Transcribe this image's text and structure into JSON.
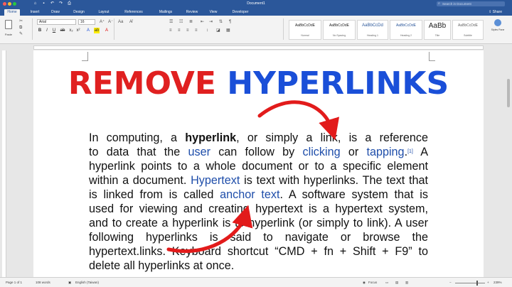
{
  "window": {
    "title": "Document1",
    "search_placeholder": "Search in Document",
    "share_label": "Share"
  },
  "tabs": [
    "Home",
    "Insert",
    "Draw",
    "Design",
    "Layout",
    "References",
    "Mailings",
    "Review",
    "View",
    "Developer"
  ],
  "active_tab": "Home",
  "ribbon": {
    "paste_label": "Paste",
    "font_name": "Arial",
    "font_size": "16",
    "styles": [
      {
        "sample": "AaBbCcDdE",
        "name": "Normal"
      },
      {
        "sample": "AaBbCcDdE",
        "name": "No Spacing"
      },
      {
        "sample": "AaBbCcDd",
        "name": "Heading 1"
      },
      {
        "sample": "AaBbCcDdE",
        "name": "Heading 2"
      },
      {
        "sample": "AaBb",
        "name": "Title"
      },
      {
        "sample": "AaBbCcDdE",
        "name": "Subtitle"
      }
    ],
    "styles_pane_label": "Styles Pane"
  },
  "headline": {
    "part1": "REMOVE",
    "part2": "HYPERLINKS"
  },
  "body": {
    "l1": [
      "In computing, a ",
      "hyperlink",
      ", or simply a ",
      "link",
      ", is a reference"
    ],
    "l2": [
      "to data that the ",
      "user",
      " can follow by ",
      "clicking",
      " or ",
      "tapping",
      ".",
      "[1]",
      " A"
    ],
    "l3": "hyperlink points to a whole document or to a specific element",
    "l4": [
      "within a document. ",
      "Hypertext",
      " is text with hyperlinks. The text that"
    ],
    "l5": [
      "is linked from is called ",
      "anchor text",
      ". A software system that is"
    ],
    "l6": "used for viewing and creating hypertext is a hypertext system,",
    "l7": "and to create a hyperlink is to hyperlink (or simply to link). A user",
    "l8": "following hyperlinks is said to navigate or browse the",
    "l9": "hypertext.links. Keyboard shortcut “CMD + fn + Shift + F9” to",
    "l10": "delete all hyperlinks at once."
  },
  "status": {
    "page": "Page 1 of 1",
    "words": "108 words",
    "language": "English (Taiwan)",
    "focus": "Focus",
    "zoom": "239%"
  },
  "colors": {
    "word_blue": "#2b579a",
    "headline_red": "#e02020",
    "headline_blue": "#1a4fd8",
    "link_blue": "#1f4eaa",
    "arrow_red": "#e21b1b"
  }
}
